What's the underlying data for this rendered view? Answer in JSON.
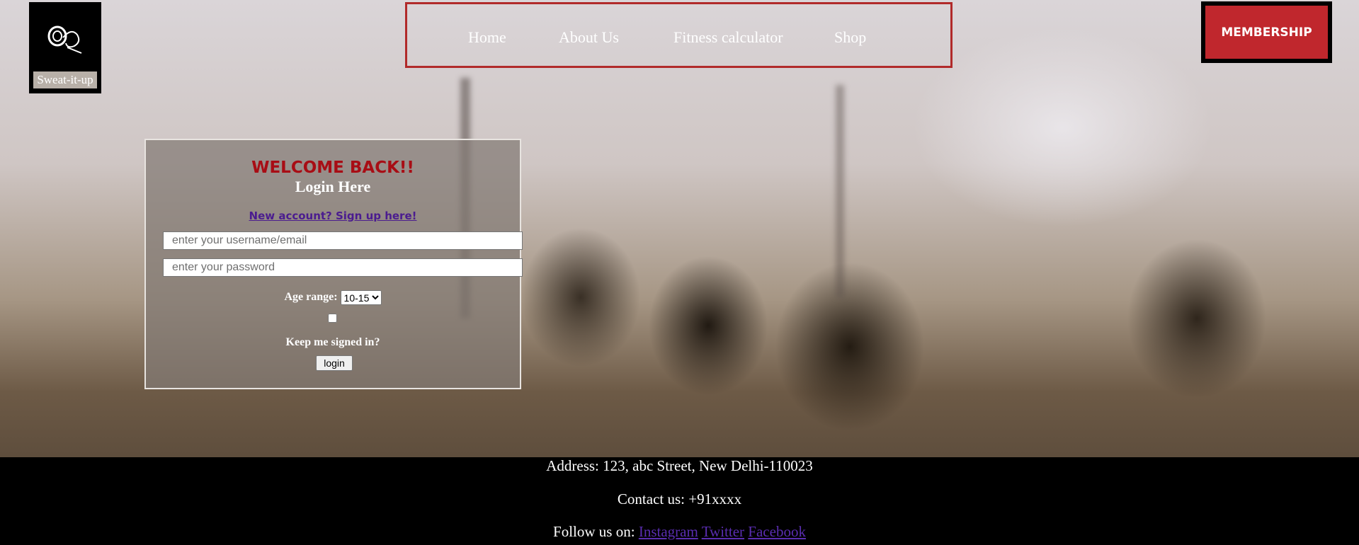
{
  "brand": {
    "name": "Sweat-it-up",
    "logo_icon": "barbell-logo-icon"
  },
  "nav": {
    "items": [
      "Home",
      "About Us",
      "Fitness calculator",
      "Shop"
    ]
  },
  "membership_label": "MEMBERSHIP",
  "login": {
    "welcome": "WELCOME BACK!!",
    "title": "Login Here",
    "signup_link": "New account? Sign up here!",
    "username_placeholder": "enter your username/email",
    "password_placeholder": "enter your password",
    "age_label": "Age range:",
    "age_selected": "10-15",
    "keep_signed_in": "Keep me signed in?",
    "button": "login"
  },
  "footer": {
    "address": "Address: 123, abc Street, New Delhi-110023",
    "contact": "Contact us: +91xxxx",
    "follow_label": "Follow us on:",
    "links": [
      "Instagram",
      "Twitter",
      "Facebook"
    ]
  },
  "colors": {
    "accent": "#c0272d",
    "welcome": "#a80d15",
    "link": "#5a2db0"
  }
}
